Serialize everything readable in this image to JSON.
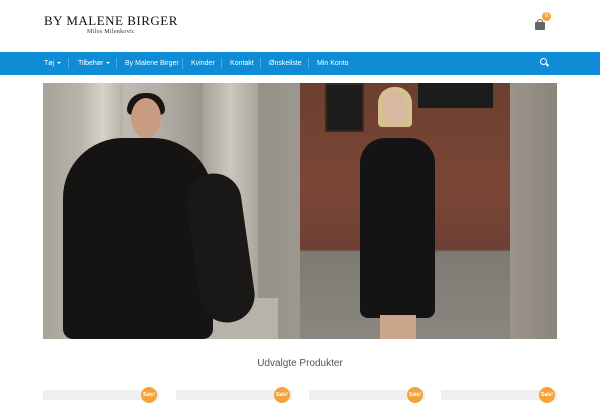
{
  "header": {
    "brand": "BY MALENE BIRGER",
    "subbrand": "Milos Milenkovic",
    "cart_count": "0",
    "cart_icon": "shopping-bag-icon"
  },
  "nav": {
    "items": [
      {
        "label": "Tøj",
        "dropdown": true
      },
      {
        "label": "Tilbehør",
        "dropdown": true
      },
      {
        "label": "By Malene Birger",
        "dropdown": false
      },
      {
        "label": "Kvinder",
        "dropdown": false
      },
      {
        "label": "Kontakt",
        "dropdown": false
      },
      {
        "label": "Ønskeliste",
        "dropdown": false
      },
      {
        "label": "Min Konto",
        "dropdown": false
      }
    ],
    "search_icon": "search-icon",
    "background": "#0e8dd6"
  },
  "section": {
    "title": "Udvalgte Produkter"
  },
  "products": [
    {
      "badge": "Sale!"
    },
    {
      "badge": "Sale!"
    },
    {
      "badge": "Sale!"
    },
    {
      "badge": "Sale!"
    }
  ],
  "colors": {
    "accent": "#0e8dd6",
    "badge": "#f2a33a"
  }
}
